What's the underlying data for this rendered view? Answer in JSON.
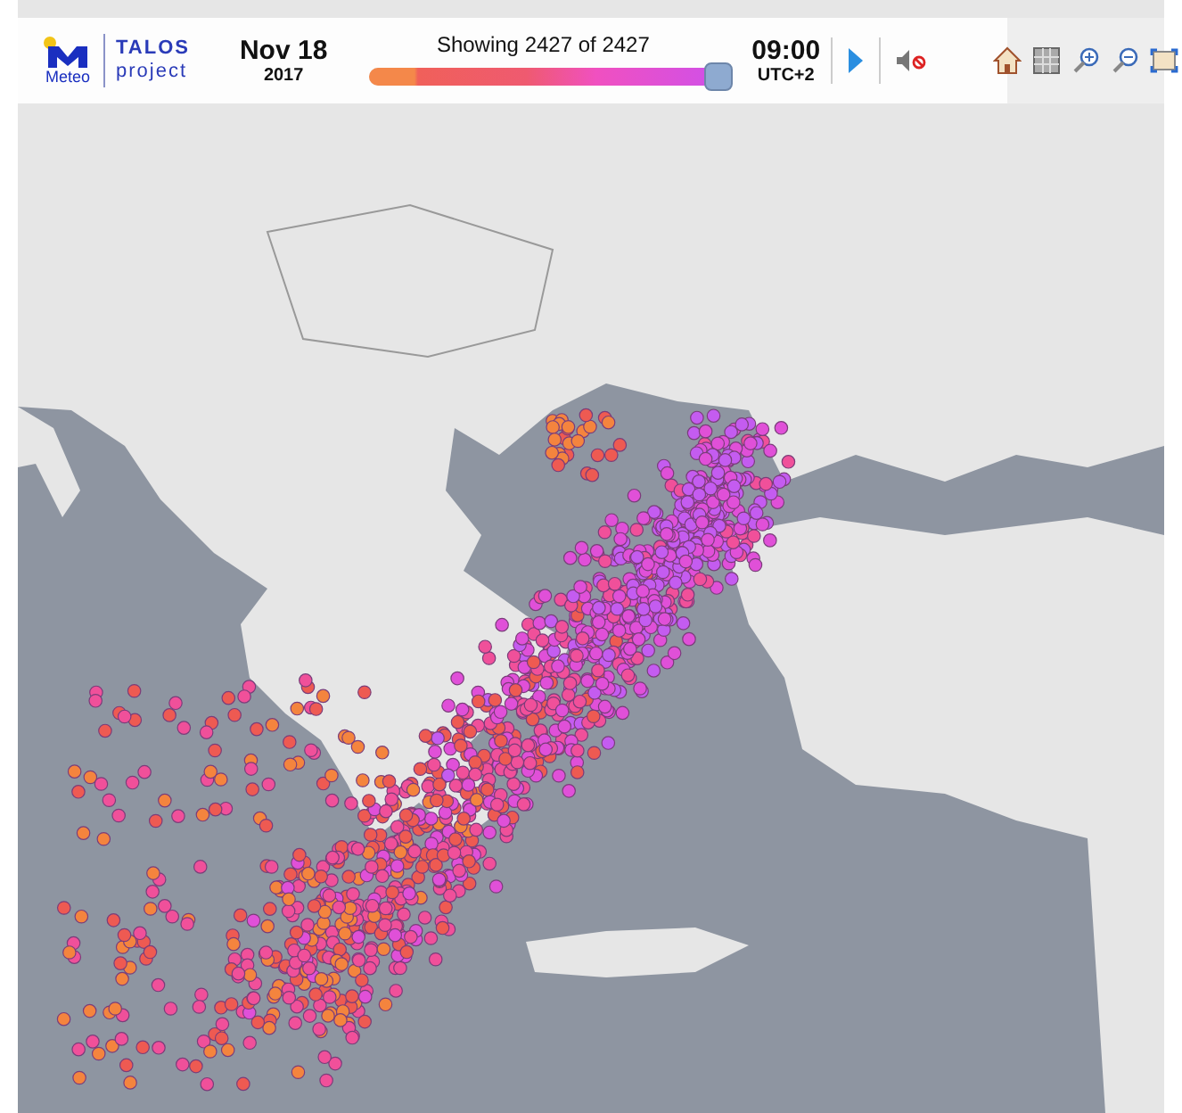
{
  "logo": {
    "brand": "Meteo",
    "product_line1": "TALOS",
    "product_line2": "project"
  },
  "date": {
    "day": "Nov 18",
    "year": "2017"
  },
  "timeline": {
    "caption": "Showing 2427 of 2427",
    "level": 1
  },
  "time": {
    "clock": "09:00",
    "zone": "UTC+2"
  },
  "controls": {
    "playing": false,
    "sound_muted": true
  }
}
